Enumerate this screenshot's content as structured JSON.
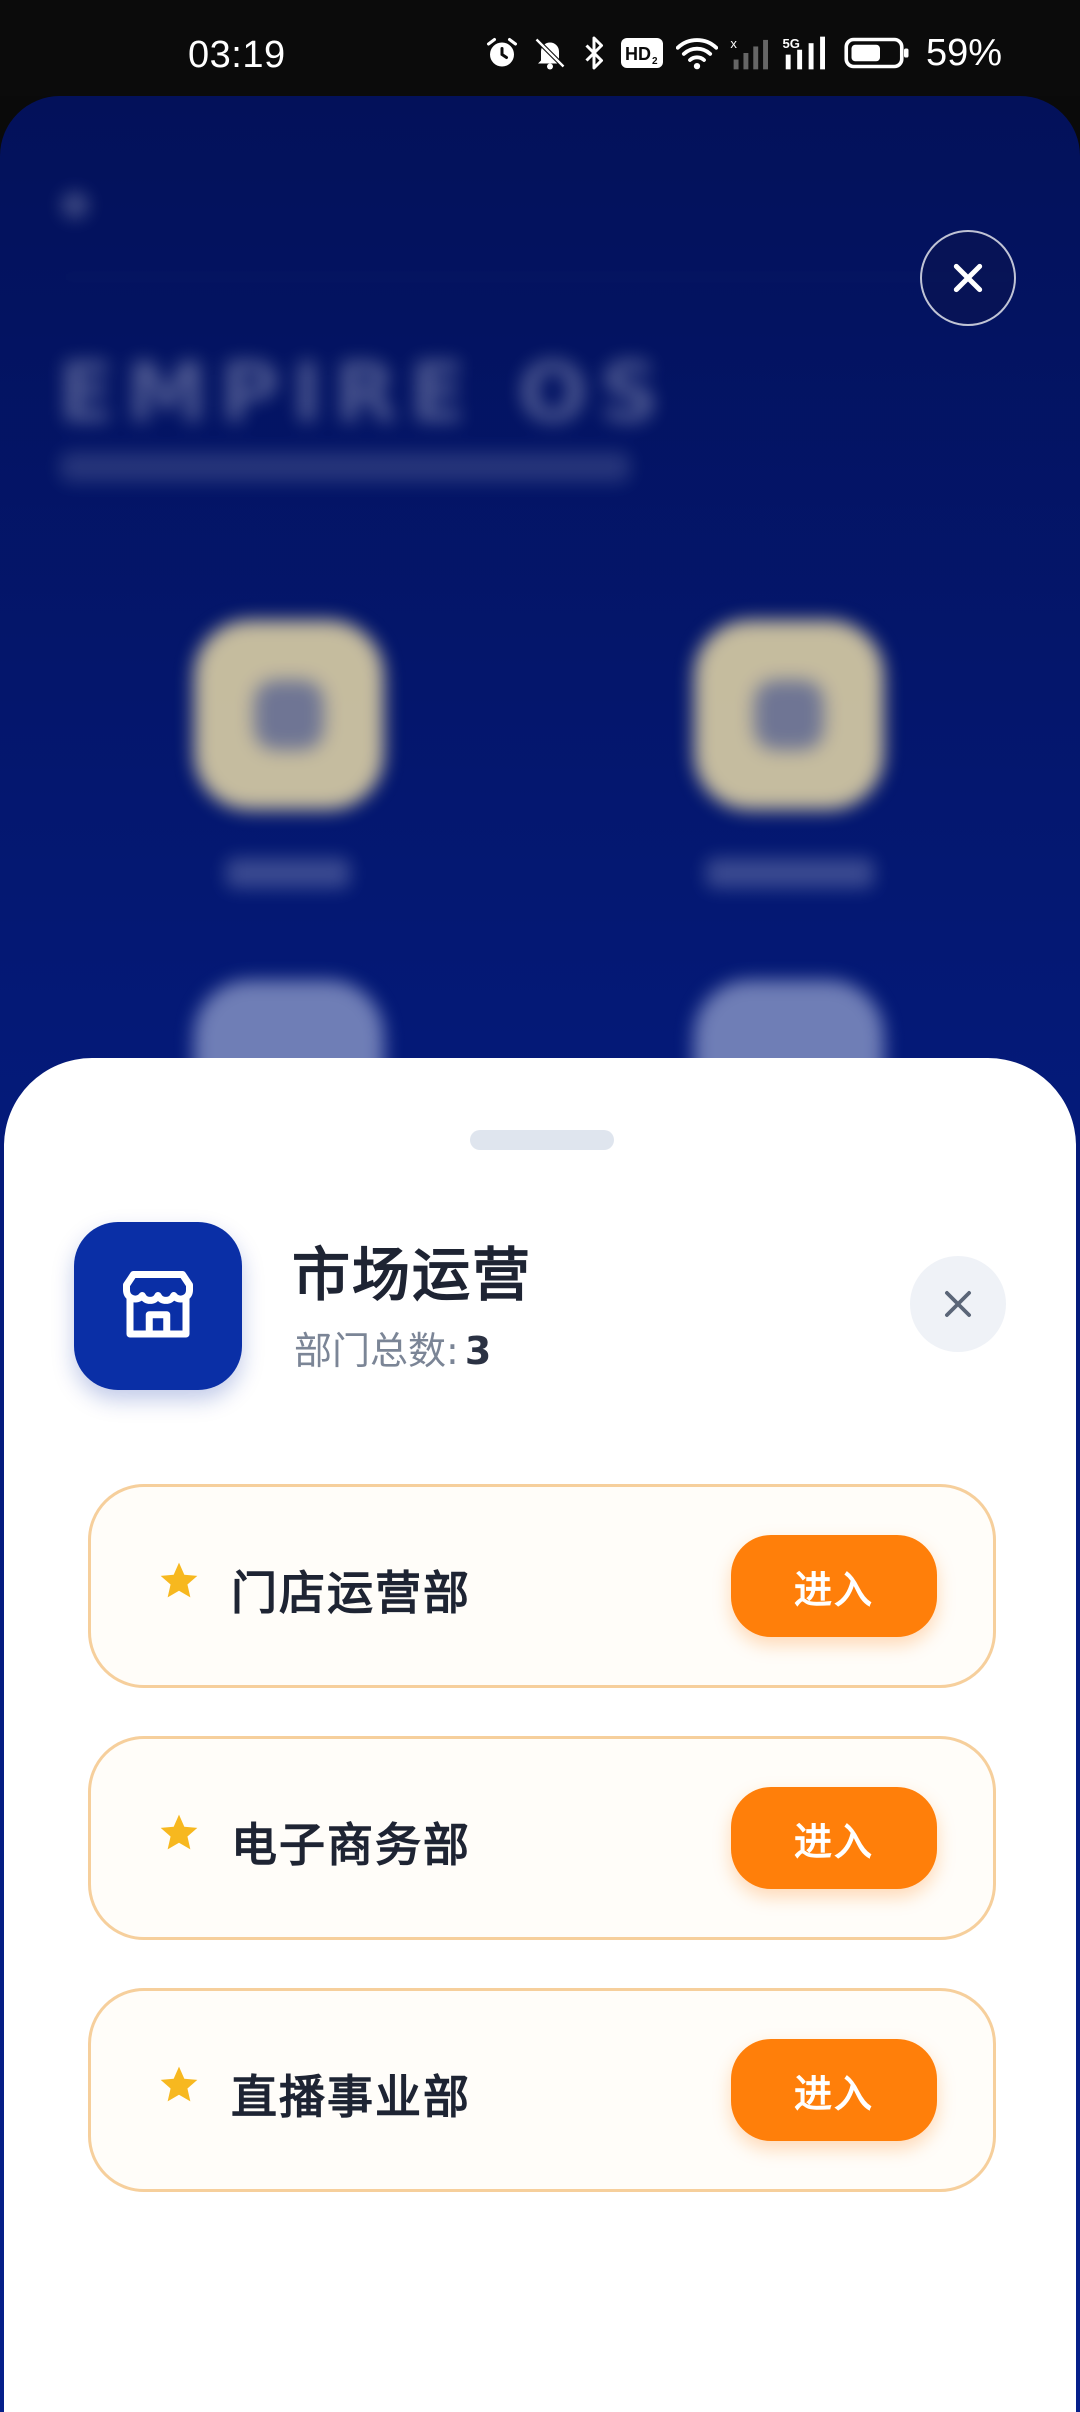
{
  "status_bar": {
    "time": "03:19",
    "battery_percent": "59%",
    "network_label": "5G",
    "icons": [
      "alarm-icon",
      "mute-icon",
      "bluetooth-icon",
      "hd-icon",
      "wifi-icon",
      "signal-icon",
      "battery-icon"
    ]
  },
  "background_app": {
    "title": "EMPIRE OS"
  },
  "sheet": {
    "title": "市场运营",
    "count_label": "部门总数:",
    "count_value": "3",
    "icon": "store-icon",
    "departments": [
      {
        "name": "门店运营部",
        "button": "进入"
      },
      {
        "name": "电子商务部",
        "button": "进入"
      },
      {
        "name": "直播事业部",
        "button": "进入"
      }
    ]
  },
  "colors": {
    "brand_blue": "#0a2fa6",
    "accent_orange": "#ff7f0a",
    "star_yellow": "#f7b81f",
    "card_border": "#f6cf9c"
  }
}
